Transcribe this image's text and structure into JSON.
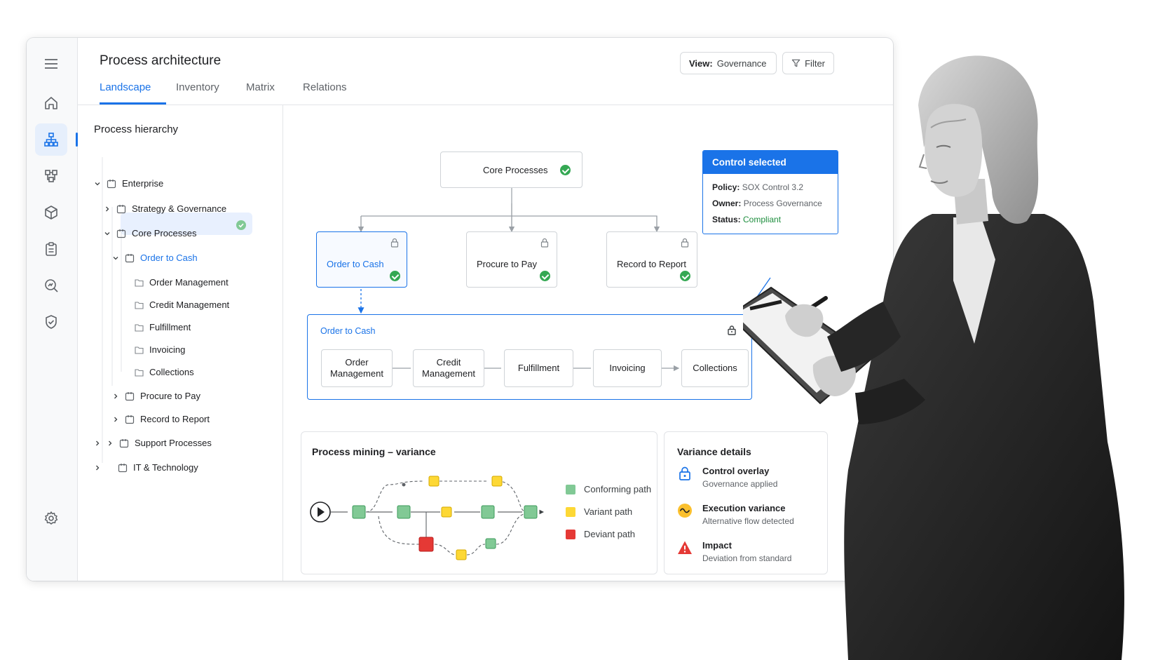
{
  "app": {
    "title": "Process architecture",
    "tabs": [
      {
        "label": "Landscape",
        "active": true
      },
      {
        "label": "Inventory"
      },
      {
        "label": "Matrix"
      },
      {
        "label": "Relations"
      }
    ],
    "view_label": "View:",
    "view_value": "Governance",
    "filter_label": "Filter",
    "accent": "#1a73e8"
  },
  "rail": {
    "icons": [
      "menu-icon",
      "home-icon",
      "hierarchy-icon",
      "process-map-icon",
      "cube-icon",
      "clipboard-icon",
      "search-analytics-icon",
      "shield-check-icon",
      "gear-icon"
    ]
  },
  "tree": {
    "title": "Process hierarchy",
    "items": [
      {
        "label": "Enterprise"
      },
      {
        "label": "Strategy & Governance"
      },
      {
        "label": "Core Processes"
      },
      {
        "label": "Order to Cash",
        "selected": true,
        "status": "compliant"
      },
      {
        "label": "Order Management"
      },
      {
        "label": "Credit Management"
      },
      {
        "label": "Fulfillment"
      },
      {
        "label": "Invoicing"
      },
      {
        "label": "Collections"
      },
      {
        "label": "Procure to Pay"
      },
      {
        "label": "Record to Report"
      },
      {
        "label": "Support Processes"
      },
      {
        "label": "IT & Technology"
      }
    ]
  },
  "diagram": {
    "root": {
      "label": "Core Processes",
      "status": "compliant"
    },
    "children": [
      {
        "label": "Order to Cash",
        "selected": true,
        "locked": true,
        "status": "compliant"
      },
      {
        "label": "Procure to Pay",
        "locked": true,
        "status": "compliant"
      },
      {
        "label": "Record to Report",
        "locked": true,
        "status": "compliant"
      }
    ],
    "expanded": {
      "title": "Order to Cash",
      "steps": [
        {
          "line1": "Order",
          "line2": "Management"
        },
        {
          "line1": "Credit",
          "line2": "Management"
        },
        {
          "line1": "Fulfillment",
          "line2": ""
        },
        {
          "line1": "Invoicing",
          "line2": ""
        },
        {
          "line1": "Collections",
          "line2": ""
        }
      ]
    }
  },
  "control_popup": {
    "header": "Control selected",
    "policy_label": "Policy:",
    "policy_value": "SOX Control 3.2",
    "owner_label": "Owner:",
    "owner_value": "Process Governance",
    "status_label": "Status:",
    "status_value": "Compliant",
    "status_color": "#1e8e3e"
  },
  "mining": {
    "title": "Process mining – variance",
    "legend": [
      {
        "label": "Conforming path",
        "color": "#81c995"
      },
      {
        "label": "Variant path",
        "color": "#fdd835"
      },
      {
        "label": "Deviant path",
        "color": "#e53935"
      }
    ]
  },
  "variance": {
    "title": "Variance details",
    "items": [
      {
        "title": "Control overlay",
        "subtitle": "Governance applied",
        "icon": "lock-icon"
      },
      {
        "title": "Execution variance",
        "subtitle": "Alternative flow detected",
        "icon": "wave-icon"
      },
      {
        "title": "Impact",
        "subtitle": "Deviation from standard",
        "icon": "warning-icon"
      }
    ]
  }
}
